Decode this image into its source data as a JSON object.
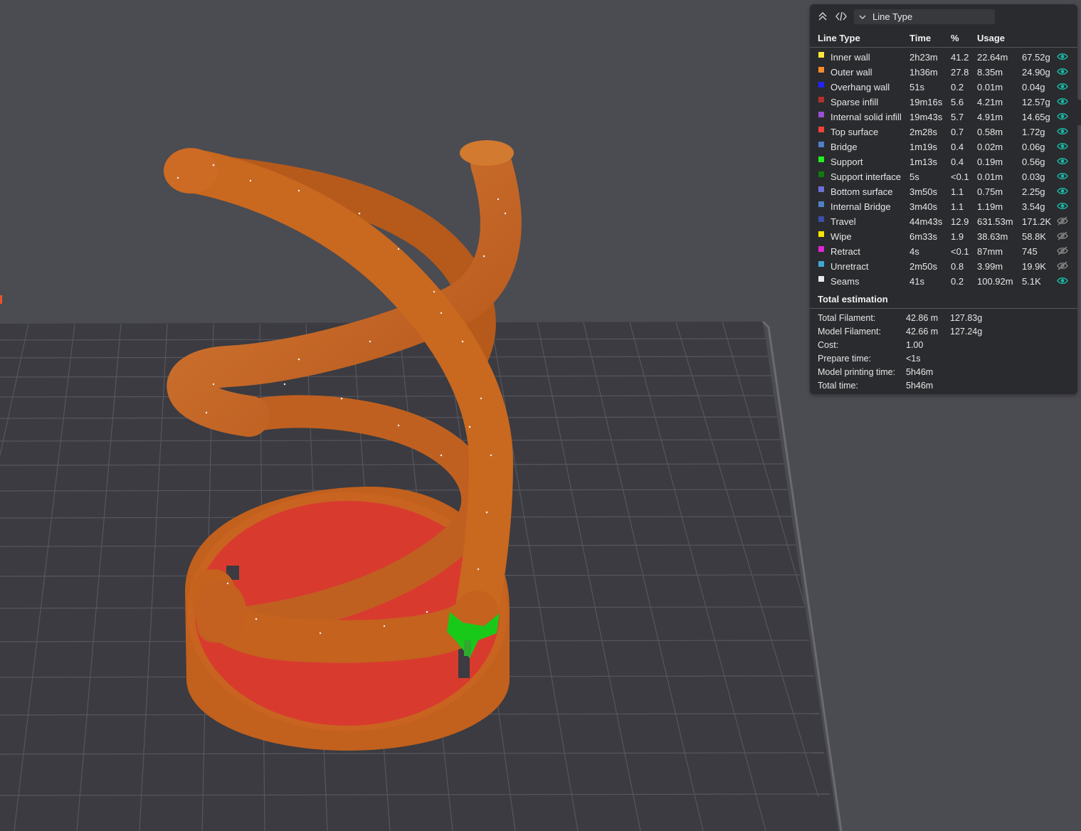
{
  "colors": {
    "background": "#4b4b52",
    "bed": "#3a3a40",
    "bed_grid": "#55555c",
    "model_orange": "#c9661f",
    "model_red": "#d63a2c",
    "support_green": "#19c919",
    "visible_eye": "#19b8a4",
    "hidden_eye": "#8a8a8a"
  },
  "legend": {
    "view_type": "Line Type",
    "collapse_icon": "chevrons-up-icon",
    "code_icon": "code-brackets-icon",
    "dropdown_icon": "chevron-down-icon",
    "headers": {
      "name": "Line Type",
      "time": "Time",
      "percent": "%",
      "usage": "Usage"
    },
    "rows": [
      {
        "name": "Inner wall",
        "color": "#ffe63c",
        "time": "2h23m",
        "percent": "41.2",
        "length": "22.64m",
        "weight": "67.52g",
        "visible": true
      },
      {
        "name": "Outer wall",
        "color": "#ff8a2e",
        "time": "1h36m",
        "percent": "27.8",
        "length": "8.35m",
        "weight": "24.90g",
        "visible": true
      },
      {
        "name": "Overhang wall",
        "color": "#2323ff",
        "time": "51s",
        "percent": "0.2",
        "length": "0.01m",
        "weight": "0.04g",
        "visible": true
      },
      {
        "name": "Sparse infill",
        "color": "#b3312b",
        "time": "19m16s",
        "percent": "5.6",
        "length": "4.21m",
        "weight": "12.57g",
        "visible": true
      },
      {
        "name": "Internal solid infill",
        "color": "#9a4ed1",
        "time": "19m43s",
        "percent": "5.7",
        "length": "4.91m",
        "weight": "14.65g",
        "visible": true
      },
      {
        "name": "Top surface",
        "color": "#f24336",
        "time": "2m28s",
        "percent": "0.7",
        "length": "0.58m",
        "weight": "1.72g",
        "visible": true
      },
      {
        "name": "Bridge",
        "color": "#4f80c6",
        "time": "1m19s",
        "percent": "0.4",
        "length": "0.02m",
        "weight": "0.06g",
        "visible": true
      },
      {
        "name": "Support",
        "color": "#22ee22",
        "time": "1m13s",
        "percent": "0.4",
        "length": "0.19m",
        "weight": "0.56g",
        "visible": true
      },
      {
        "name": "Support interface",
        "color": "#0f7a0f",
        "time": "5s",
        "percent": "<0.1",
        "length": "0.01m",
        "weight": "0.03g",
        "visible": true
      },
      {
        "name": "Bottom surface",
        "color": "#6f6fd8",
        "time": "3m50s",
        "percent": "1.1",
        "length": "0.75m",
        "weight": "2.25g",
        "visible": true
      },
      {
        "name": "Internal Bridge",
        "color": "#4f80c6",
        "time": "3m40s",
        "percent": "1.1",
        "length": "1.19m",
        "weight": "3.54g",
        "visible": true
      },
      {
        "name": "Travel",
        "color": "#3b4fa8",
        "time": "44m43s",
        "percent": "12.9",
        "length": "631.53m",
        "weight": "171.2K",
        "visible": false
      },
      {
        "name": "Wipe",
        "color": "#f5e600",
        "time": "6m33s",
        "percent": "1.9",
        "length": "38.63m",
        "weight": "58.8K",
        "visible": false
      },
      {
        "name": "Retract",
        "color": "#e025d8",
        "time": "4s",
        "percent": "<0.1",
        "length": "87mm",
        "weight": "745",
        "visible": false
      },
      {
        "name": "Unretract",
        "color": "#3fa6d6",
        "time": "2m50s",
        "percent": "0.8",
        "length": "3.99m",
        "weight": "19.9K",
        "visible": false
      },
      {
        "name": "Seams",
        "color": "#e8e8e8",
        "time": "41s",
        "percent": "0.2",
        "length": "100.92m",
        "weight": "5.1K",
        "visible": true
      }
    ]
  },
  "totals": {
    "title": "Total estimation",
    "rows": [
      {
        "label": "Total Filament:",
        "a": "42.86 m",
        "b": "127.83g"
      },
      {
        "label": "Model Filament:",
        "a": "42.66 m",
        "b": "127.24g"
      },
      {
        "label": "Cost:",
        "a": "1.00",
        "b": ""
      },
      {
        "label": "Prepare time:",
        "a": "<1s",
        "b": ""
      },
      {
        "label": "Model printing time:",
        "a": "5h46m",
        "b": ""
      },
      {
        "label": "Total time:",
        "a": "5h46m",
        "b": ""
      }
    ]
  }
}
